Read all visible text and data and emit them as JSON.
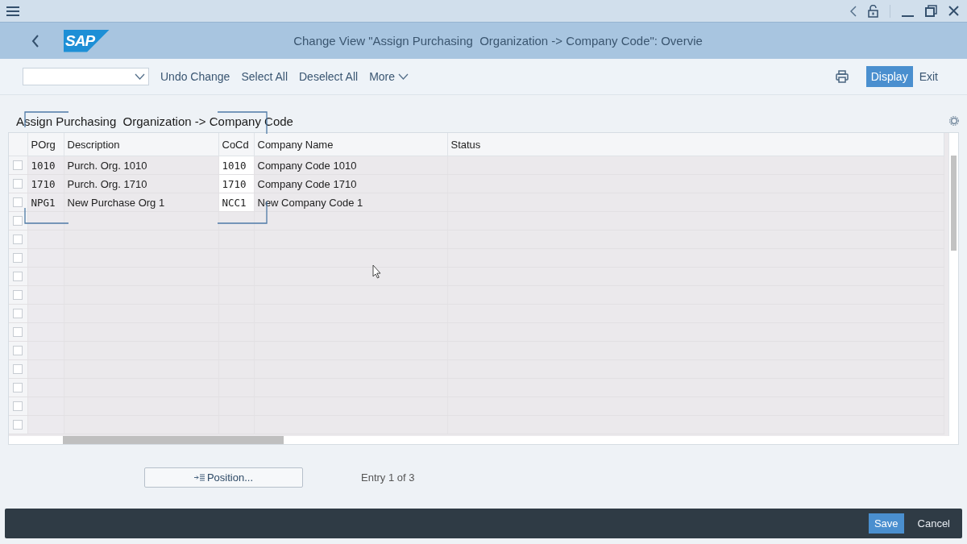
{
  "header": {
    "logo": "SAP",
    "title": "Change View \"Assign Purchasing  Organization -> Company Code\": Overvie"
  },
  "toolbar": {
    "left": [
      {
        "label": "Undo Change",
        "kind": "plain"
      },
      {
        "label": "Select All",
        "kind": "plain"
      },
      {
        "label": "Deselect All",
        "kind": "plain"
      },
      {
        "label": "More",
        "kind": "menu"
      }
    ],
    "right": [
      {
        "label": "Display",
        "kind": "emphasized"
      },
      {
        "label": "Exit",
        "kind": "plain"
      }
    ]
  },
  "section_title": "Assign Purchasing  Organization -> Company Code",
  "table": {
    "columns": [
      {
        "label": "POrg",
        "kind": "key"
      },
      {
        "label": "Description",
        "kind": "text"
      },
      {
        "label": "CoCd",
        "kind": "key"
      },
      {
        "label": "Company Name",
        "kind": "text"
      },
      {
        "label": "Status",
        "kind": "text"
      }
    ],
    "rows": [
      {
        "checked": false,
        "cells": [
          "1010",
          "Purch. Org. 1010",
          "1010",
          "Company Code 1010"
        ]
      },
      {
        "checked": false,
        "cells": [
          "1710",
          "Purch. Org. 1710",
          "1710",
          "Company Code 1710"
        ]
      },
      {
        "checked": false,
        "cells": [
          "NPG1",
          "New Purchase Org 1",
          "NCC1",
          "New Company Code 1"
        ]
      },
      {
        "checked": false,
        "cells": []
      },
      {
        "checked": false,
        "cells": []
      },
      {
        "checked": false,
        "cells": []
      },
      {
        "checked": false,
        "cells": []
      },
      {
        "checked": false,
        "cells": []
      },
      {
        "checked": false,
        "cells": []
      },
      {
        "checked": false,
        "cells": []
      },
      {
        "checked": false,
        "cells": []
      },
      {
        "checked": false,
        "cells": []
      },
      {
        "checked": false,
        "cells": []
      },
      {
        "checked": false,
        "cells": []
      },
      {
        "checked": false,
        "cells": []
      }
    ]
  },
  "position_button": "Position...",
  "entry_info": "Entry 1 of 3",
  "footer": [
    {
      "label": "Save",
      "kind": "emphasized"
    },
    {
      "label": "Cancel",
      "kind": "plain"
    }
  ]
}
